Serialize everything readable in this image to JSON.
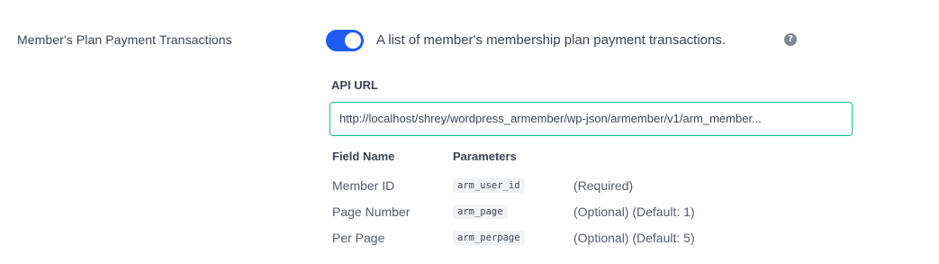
{
  "setting": {
    "label": "Member's Plan Payment Transactions",
    "toggle_on": true,
    "description": "A list of member's membership plan payment transactions.",
    "help_icon": "question-circle-icon"
  },
  "api": {
    "label": "API URL",
    "url": "http://localhost/shrey/wordpress_armember/wp-json/armember/v1/arm_member..."
  },
  "params": {
    "headers": {
      "field": "Field Name",
      "param": "Parameters"
    },
    "rows": [
      {
        "field": "Member ID",
        "param": "arm_user_id",
        "note": "(Required)"
      },
      {
        "field": "Page Number",
        "param": "arm_page",
        "note": "(Optional) (Default: 1)"
      },
      {
        "field": "Per Page",
        "param": "arm_perpage",
        "note": "(Optional) (Default: 5)"
      }
    ]
  },
  "colors": {
    "toggle_on": "#1e5cf5",
    "input_border": "#1abc9c"
  }
}
